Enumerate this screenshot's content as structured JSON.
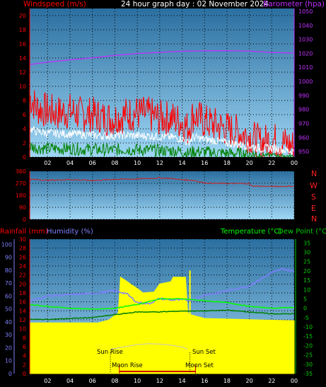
{
  "header": {
    "left_label": "Windspeed (m/s)",
    "title": "24 hour graph day : 02 November 2024",
    "right_label": "Barometer (hpa)"
  },
  "colors": {
    "background": "#000000",
    "plot_bg_top": "#2b6fa0",
    "plot_bg_bottom": "#9fd6f4",
    "wind_max": "#ff0000",
    "wind_avg": "#ffffff",
    "wind_min": "#008000",
    "barometer": "#c030ff",
    "direction": "#cc2222",
    "rain": "#ffff00",
    "humidity": "#8080ff",
    "temperature": "#00ff00",
    "dewpoint": "#008000",
    "sun_arc": "#c8c8c8",
    "moon": "#cc0000",
    "red_axis": "#ff0000",
    "green_axis": "#00cc00"
  },
  "compass_labels": [
    "N",
    "W",
    "S",
    "E",
    "N"
  ],
  "bottom_labels": {
    "rainfall": "Rainfall (mm)",
    "humidity": "Humidity (%)",
    "temperature": "Temperature (°C)",
    "dewpoint": "Dew Point (°C)",
    "sun_rise": "Sun Rise",
    "sun_set": "Sun Set",
    "moon_rise": "Moon Rise",
    "moon_set": "Moon Set"
  },
  "chart_data": [
    {
      "type": "line",
      "id": "wind_pressure",
      "x_ticks": [
        "02",
        "04",
        "06",
        "08",
        "10",
        "12",
        "14",
        "16",
        "18",
        "20",
        "22",
        "00"
      ],
      "y_left_ticks": [
        "0",
        "2",
        "4",
        "6",
        "8",
        "10",
        "12",
        "14",
        "16",
        "18",
        "20"
      ],
      "y_right_ticks": [
        "950",
        "960",
        "970",
        "980",
        "990",
        "1000",
        "1010",
        "1020",
        "1030",
        "1040",
        "1050"
      ],
      "ylim_left": [
        0,
        21
      ],
      "ylim_right": [
        946,
        1052
      ],
      "xlim": [
        0.4,
        24
      ],
      "grid": true,
      "series": [
        {
          "key": "wind_max",
          "x": [
            0.4,
            1,
            2,
            3,
            4,
            5,
            6,
            7,
            8,
            9,
            10,
            11,
            12,
            13,
            14,
            14.5,
            15,
            16,
            17,
            18,
            19,
            20,
            21,
            22,
            23,
            24
          ],
          "values": [
            8.5,
            7,
            6.5,
            6.2,
            6.5,
            6,
            6,
            5.5,
            5.5,
            6,
            6.2,
            6,
            5.5,
            5.5,
            5,
            4,
            6,
            5,
            4.5,
            4,
            3.5,
            3,
            2,
            2.5,
            2,
            1.5
          ]
        },
        {
          "key": "wind_avg",
          "x": [
            0.4,
            1,
            2,
            3,
            4,
            5,
            6,
            7,
            8,
            9,
            10,
            11,
            12,
            13,
            14,
            14.5,
            15,
            16,
            17,
            18,
            19,
            20,
            21,
            22,
            23,
            24
          ],
          "values": [
            4,
            3.6,
            3.4,
            3.3,
            3.3,
            3.2,
            3.1,
            3,
            3,
            3.1,
            3,
            3,
            2.9,
            2.8,
            2.6,
            2,
            2.8,
            2.5,
            2.3,
            2,
            1.8,
            1.6,
            1.2,
            1.3,
            1,
            0.8
          ]
        },
        {
          "key": "wind_min",
          "x": [
            0.4,
            1,
            2,
            3,
            4,
            5,
            6,
            7,
            8,
            9,
            10,
            11,
            12,
            13,
            14,
            14.5,
            15,
            16,
            17,
            18,
            19,
            20,
            21,
            22,
            23,
            24
          ],
          "values": [
            1.5,
            1.3,
            1.2,
            1.2,
            1.2,
            1.1,
            1.1,
            1,
            1,
            1.1,
            1,
            1,
            0.9,
            0.9,
            0.8,
            0.5,
            0.8,
            0.7,
            0.6,
            0.5,
            0.5,
            0.4,
            0.3,
            0.3,
            0.2,
            0.1
          ]
        },
        {
          "key": "barometer",
          "axis": "right",
          "x": [
            0.4,
            2,
            4,
            6,
            8,
            10,
            12,
            14,
            16,
            18,
            20,
            22,
            24
          ],
          "values": [
            1012,
            1013.8,
            1015.3,
            1016.8,
            1018.5,
            1019.9,
            1020.7,
            1021.5,
            1021.8,
            1021.9,
            1021.6,
            1020.6,
            1020.2
          ]
        }
      ]
    },
    {
      "type": "line",
      "id": "direction",
      "y_ticks": [
        "0",
        "90",
        "180",
        "270",
        "360"
      ],
      "ylim": [
        0,
        360
      ],
      "xlim": [
        0.4,
        24
      ],
      "series": [
        {
          "key": "direction",
          "x": [
            0.4,
            2,
            4,
            6,
            8,
            10,
            12,
            13,
            14,
            15,
            16,
            17,
            18,
            19,
            20,
            20.1,
            22,
            24
          ],
          "values": [
            300,
            292,
            298,
            290,
            300,
            302,
            310,
            306,
            296,
            292,
            272,
            270,
            268,
            268,
            268,
            250,
            246,
            248
          ]
        }
      ]
    },
    {
      "type": "area",
      "id": "rain_humidity_temp",
      "x_ticks": [
        "02",
        "04",
        "06",
        "08",
        "10",
        "12",
        "14",
        "16",
        "18",
        "20",
        "22",
        "00"
      ],
      "y_humidity_ticks": [
        "0",
        "10",
        "20",
        "30",
        "40",
        "50",
        "60",
        "70",
        "80",
        "90",
        "100"
      ],
      "y_rain_ticks": [
        "0",
        "2",
        "4",
        "6",
        "8",
        "10",
        "12",
        "14",
        "16",
        "18",
        "20",
        "22",
        "24",
        "26",
        "28",
        "30"
      ],
      "y_temp_ticks": [
        "35",
        "30",
        "25",
        "20",
        "15",
        "10",
        "5",
        "0",
        "-5",
        "-10",
        "-15",
        "-20",
        "-25",
        "-30",
        "-35"
      ],
      "ylim_humidity": [
        0,
        104
      ],
      "ylim_rain": [
        0,
        30
      ],
      "ylim_temp": [
        -35,
        37
      ],
      "xlim": [
        0.4,
        24
      ],
      "series": [
        {
          "key": "rain",
          "axis": "rain",
          "x": [
            0.4,
            6.5,
            7.5,
            8,
            8.3,
            8.5,
            9,
            9.5,
            10,
            10.5,
            11.5,
            12,
            13,
            13.2,
            14.3,
            14.5,
            14.6,
            14.7,
            16,
            24
          ],
          "values": [
            11.3,
            11.3,
            12,
            13,
            13.5,
            21.5,
            20.7,
            19.8,
            19,
            18,
            18.2,
            20,
            20.5,
            21.5,
            21.5,
            13.7,
            13.3,
            13.2,
            12.3,
            11.8
          ]
        },
        {
          "key": "humidity",
          "axis": "humidity",
          "x": [
            0.4,
            2,
            4,
            6,
            8,
            9,
            10,
            11,
            12,
            13,
            14,
            15,
            16,
            17,
            18,
            19,
            20,
            21,
            22,
            23,
            24
          ],
          "values": [
            56,
            60,
            61,
            62,
            64,
            62,
            55,
            54,
            58,
            57,
            57,
            57,
            61,
            62,
            64,
            66,
            68,
            73,
            78,
            81,
            79
          ]
        },
        {
          "key": "temperature",
          "axis": "temp",
          "x": [
            0.4,
            2,
            4,
            6,
            8,
            10,
            12,
            14,
            16,
            18,
            20,
            22,
            24
          ],
          "values": [
            2,
            1,
            0,
            -0.5,
            0,
            2,
            5,
            5,
            4,
            3,
            1,
            0,
            0.5
          ]
        },
        {
          "key": "dewpoint",
          "axis": "temp",
          "x": [
            0.4,
            2,
            4,
            6,
            8,
            10,
            12,
            14,
            16,
            18,
            20,
            22,
            24
          ],
          "values": [
            -6,
            -6,
            -5.5,
            -5,
            -3.5,
            -2,
            -2,
            -1.5,
            -1.5,
            -1,
            -2,
            -3,
            -3
          ]
        },
        {
          "key": "sun_arc",
          "axis": "temp",
          "x": [
            7.6,
            9,
            10,
            11,
            12,
            13,
            14,
            14.5
          ],
          "values": [
            -22,
            -20.5,
            -19.5,
            -19,
            -19.2,
            -19.8,
            -20.8,
            -22
          ]
        }
      ],
      "events": {
        "sun_rise_hour": 7.6,
        "sun_set_hour": 14.7,
        "moon_rise_hour": 8.4,
        "moon_set_hour": 15.2
      }
    }
  ]
}
